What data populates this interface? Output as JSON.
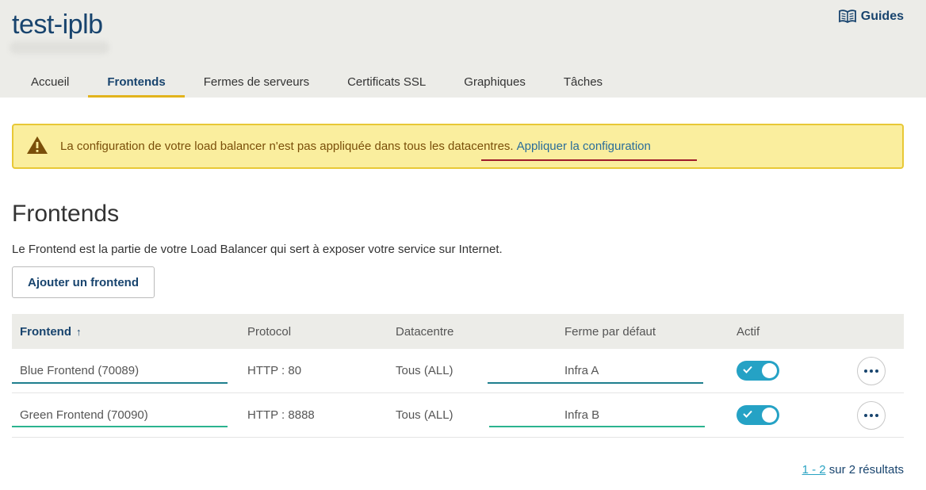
{
  "header": {
    "title": "test-iplb",
    "guides_label": "Guides",
    "guides_icon": "book-icon"
  },
  "tabs": [
    {
      "label": "Accueil",
      "active": false
    },
    {
      "label": "Frontends",
      "active": true
    },
    {
      "label": "Fermes de serveurs",
      "active": false
    },
    {
      "label": "Certificats SSL",
      "active": false
    },
    {
      "label": "Graphiques",
      "active": false
    },
    {
      "label": "Tâches",
      "active": false
    }
  ],
  "alert": {
    "icon": "warning-icon",
    "message": "La configuration de votre load balancer n'est pas appliquée dans tous les datacentres.",
    "link_label": "Appliquer la configuration"
  },
  "main": {
    "title": "Frontends",
    "description": "Le Frontend est la partie de votre Load Balancer qui sert à exposer votre service sur Internet.",
    "add_button_label": "Ajouter un frontend"
  },
  "table": {
    "columns": [
      "Frontend",
      "Protocol",
      "Datacentre",
      "Ferme par défaut",
      "Actif"
    ],
    "sort_indicator": "↑",
    "rows": [
      {
        "frontend": "Blue Frontend (70089)",
        "protocol": "HTTP : 80",
        "datacentre": "Tous (ALL)",
        "farm": "Infra A",
        "active": true
      },
      {
        "frontend": "Green Frontend (70090)",
        "protocol": "HTTP : 8888",
        "datacentre": "Tous (ALL)",
        "farm": "Infra B",
        "active": true
      }
    ]
  },
  "pagination": {
    "range": "1 - 2",
    "total_text": "sur 2 résultats"
  },
  "colors": {
    "brand": "#18446e",
    "accent": "#e2b31c",
    "toggle_on": "#25a2c5",
    "alert_bg": "#faee9e",
    "row1_underline": "#1e7f8e",
    "row2_underline": "#2bb38f"
  }
}
